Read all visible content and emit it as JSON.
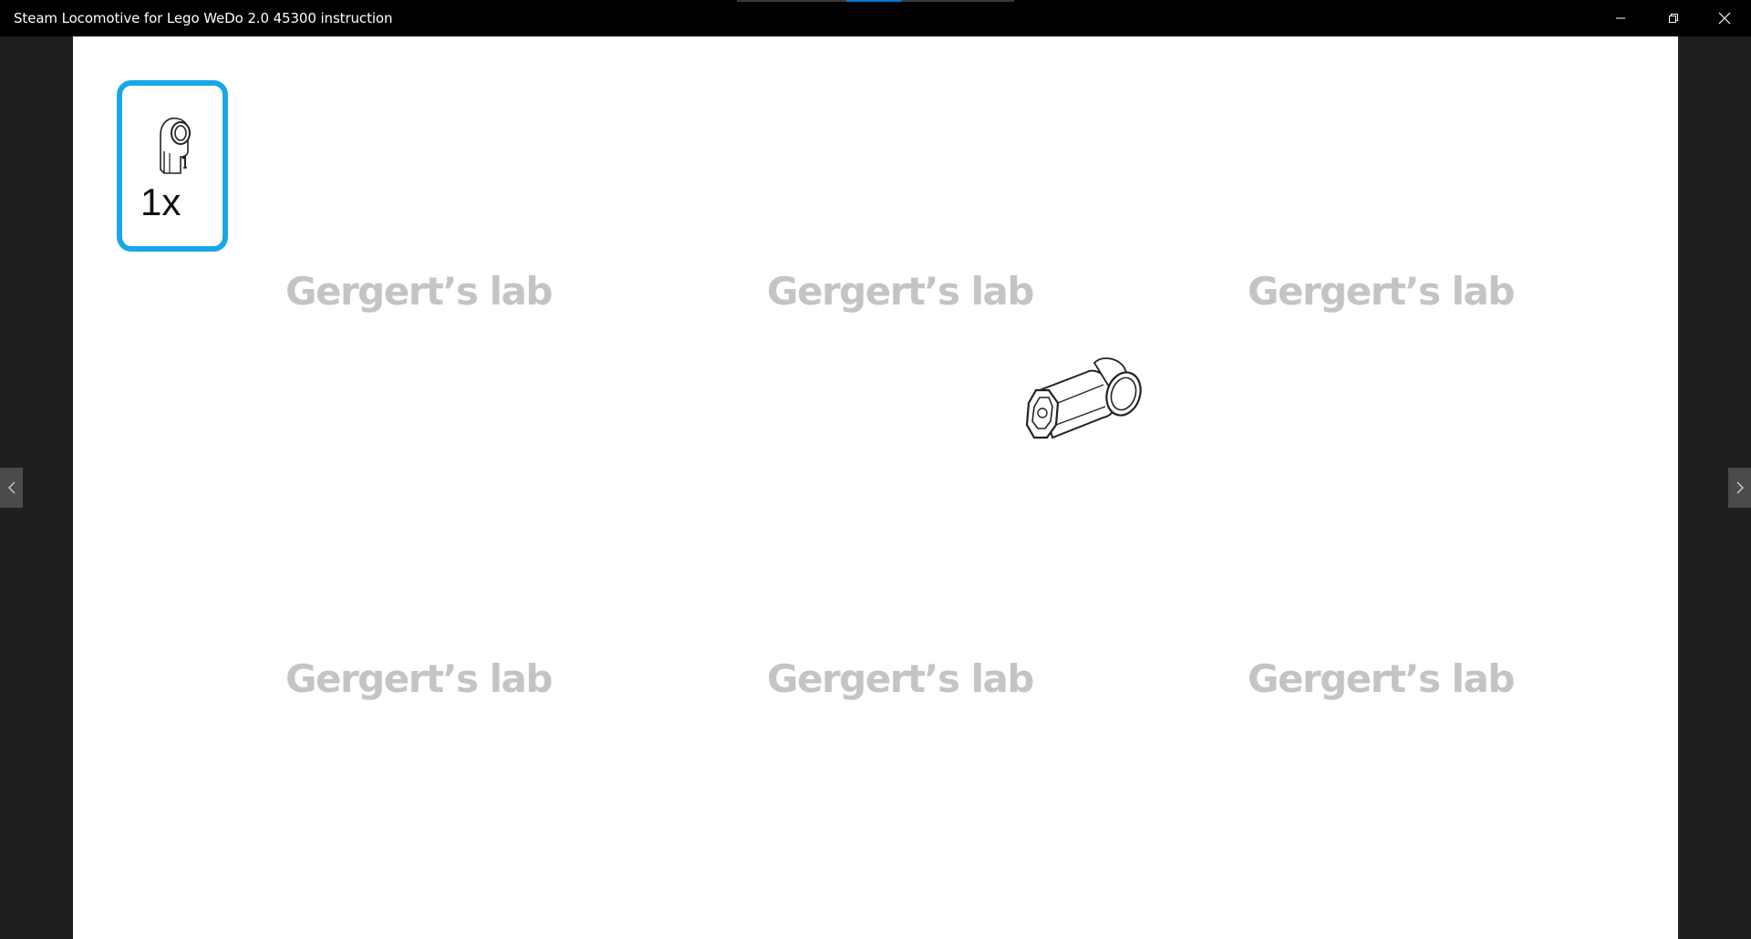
{
  "window": {
    "title": "Steam Locomotive for Lego WeDo 2.0 45300 instruction",
    "progress": 0.2,
    "controls": {
      "minimize_icon": "minimize-icon",
      "restore_icon": "restore-icon",
      "close_icon": "close-icon"
    }
  },
  "page": {
    "parts_callout": {
      "count": "1x",
      "part_icon": "axle-pin-connector-icon",
      "accent_color": "#1aa7e8"
    },
    "watermarks": [
      "Gergert’s lab",
      "Gergert’s lab",
      "Gergert’s lab",
      "Gergert’s lab",
      "Gergert’s lab",
      "Gergert’s lab"
    ],
    "model_part": "axle-pin-connector-icon"
  },
  "navigation": {
    "prev_icon": "chevron-left-icon",
    "next_icon": "chevron-right-icon"
  }
}
